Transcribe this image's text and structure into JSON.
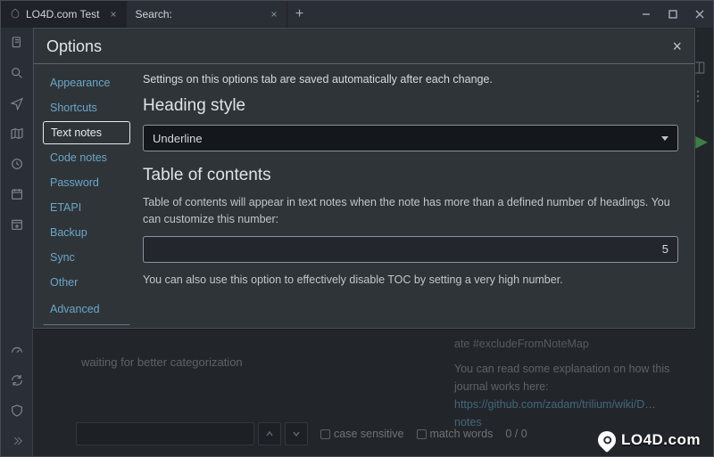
{
  "titlebar": {
    "tabs": [
      {
        "label": "LO4D.com Test",
        "active": true
      },
      {
        "label": "Search:",
        "active": false
      }
    ]
  },
  "dialog": {
    "title": "Options",
    "save_note": "Settings on this options tab are saved automatically after each change.",
    "sidebar": {
      "items": [
        {
          "label": "Appearance"
        },
        {
          "label": "Shortcuts"
        },
        {
          "label": "Text notes"
        },
        {
          "label": "Code notes"
        },
        {
          "label": "Password"
        },
        {
          "label": "ETAPI"
        },
        {
          "label": "Backup"
        },
        {
          "label": "Sync"
        },
        {
          "label": "Other"
        },
        {
          "label": "Advanced"
        }
      ],
      "active_index": 2
    },
    "heading_style": {
      "title": "Heading style",
      "value": "Underline"
    },
    "toc": {
      "title": "Table of contents",
      "desc": "Table of contents will appear in text notes when the note has more than a defined number of headings. You can customize this number:",
      "value": "5",
      "hint": "You can also use this option to effectively disable TOC by setting a very high number."
    }
  },
  "background": {
    "left_note": "waiting for better categorization",
    "right_note_line1": "ate #excludeFromNoteMap",
    "right_note_line2": "You can read some explanation on how this journal works here:",
    "right_note_link": "https://github.com/zadam/trilium/wiki/D",
    "right_note_link_tail": "notes"
  },
  "searchbar": {
    "placeholder": "",
    "case_label": "case sensitive",
    "match_label": "match words",
    "count": "0 / 0"
  },
  "watermark": "LO4D.com"
}
